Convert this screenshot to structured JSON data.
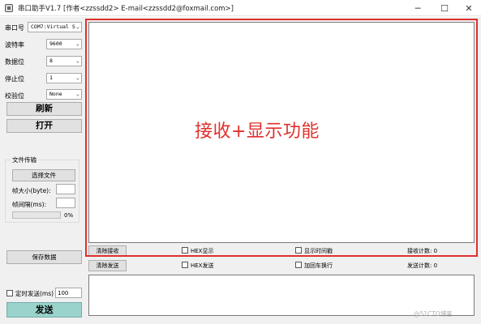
{
  "window": {
    "title": "串口助手V1.7 [作者<zzssdd2>   E-mail<zzssdd2@foxmail.com>]",
    "icon": "serial-port-app-icon",
    "controls": {
      "minimize": "─",
      "maximize": "☐",
      "close": "✕"
    }
  },
  "settings": {
    "port_label": "串口号",
    "port_value": "COM7:Virtual S",
    "baud_label": "波特率",
    "baud_value": "9600",
    "databits_label": "数据位",
    "databits_value": "8",
    "stopbits_label": "停止位",
    "stopbits_value": "1",
    "parity_label": "校验位",
    "parity_value": "None",
    "dropdown_arrow": "⌄"
  },
  "buttons": {
    "refresh": "刷新",
    "open": "打开",
    "save": "保存数据",
    "send": "发送"
  },
  "file_transfer": {
    "group_title": "文件传输",
    "choose_file": "选择文件",
    "frame_size_label": "帧大小(byte):",
    "frame_interval_label": "帧间隔(ms):",
    "progress_text": "0%",
    "progress_value": 0
  },
  "timed_send": {
    "label": "定时发送(ms)",
    "value": "100",
    "checked": false
  },
  "receive_bar": {
    "clear": "清除接收",
    "hex_display": "HEX显示",
    "show_time": "显示时间戳",
    "count": "接收计数:  0"
  },
  "send_bar": {
    "clear": "清除发送",
    "hex_send": "HEX发送",
    "add_enter": "加回车换行",
    "count": "发送计数:  0"
  },
  "annotation": {
    "text": "接收+显示功能",
    "color": "#e0302c"
  },
  "watermark": "@51CTO博客"
}
